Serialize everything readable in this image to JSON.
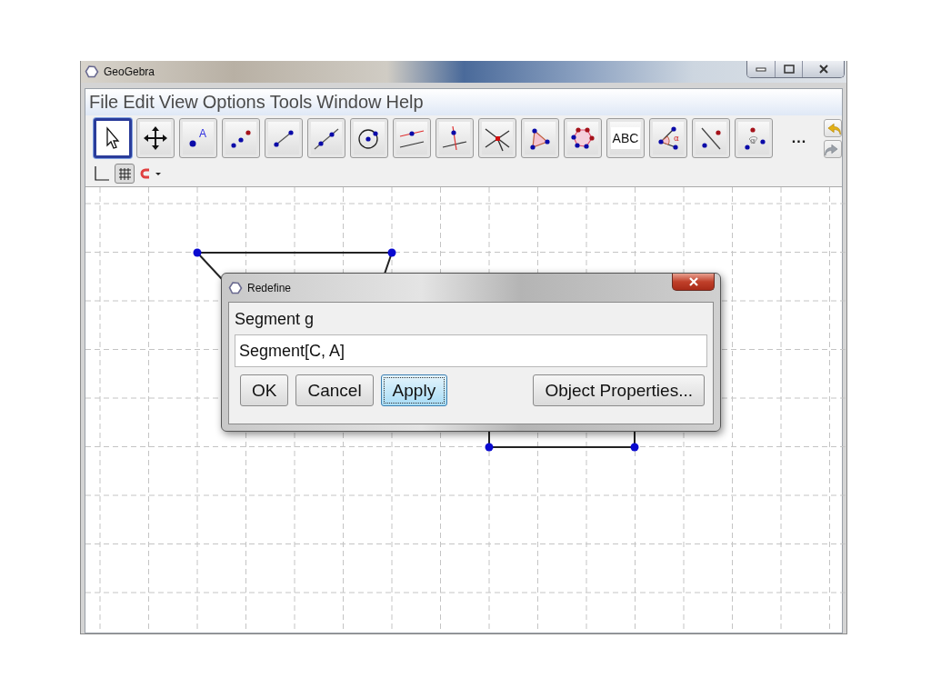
{
  "window": {
    "title": "GeoGebra"
  },
  "menu": [
    "File",
    "Edit",
    "View",
    "Options",
    "Tools",
    "Window",
    "Help"
  ],
  "tools": [
    {
      "kind": "pointer",
      "selected": true
    },
    {
      "kind": "pan",
      "selected": false
    },
    {
      "kind": "point",
      "label": "A",
      "selected": false
    },
    {
      "kind": "points",
      "selected": false
    },
    {
      "kind": "segment",
      "selected": false
    },
    {
      "kind": "line",
      "selected": false
    },
    {
      "kind": "circle",
      "selected": false
    },
    {
      "kind": "parallel",
      "selected": false
    },
    {
      "kind": "perpendicular",
      "selected": false
    },
    {
      "kind": "intersect",
      "selected": false
    },
    {
      "kind": "polygon",
      "selected": false
    },
    {
      "kind": "pentagon",
      "selected": false
    },
    {
      "kind": "text",
      "label": "ABC",
      "selected": false
    },
    {
      "kind": "angle",
      "label": "α",
      "selected": false
    },
    {
      "kind": "reflect",
      "selected": false
    },
    {
      "kind": "rotate",
      "label": "α",
      "selected": false
    }
  ],
  "more_tools": "...",
  "history": [
    {
      "kind": "undo",
      "disabled": false
    },
    {
      "kind": "redo",
      "disabled": true
    }
  ],
  "style_bar": {
    "axes_on": false,
    "grid_on": true
  },
  "dialog": {
    "title": "Redefine",
    "label": "Segment g",
    "value": "Segment[C, A]",
    "buttons": [
      {
        "label": "OK",
        "focused": false
      },
      {
        "label": "Cancel",
        "focused": false
      },
      {
        "label": "Apply",
        "focused": true
      },
      {
        "label": "Object Properties...",
        "focused": false
      }
    ]
  }
}
